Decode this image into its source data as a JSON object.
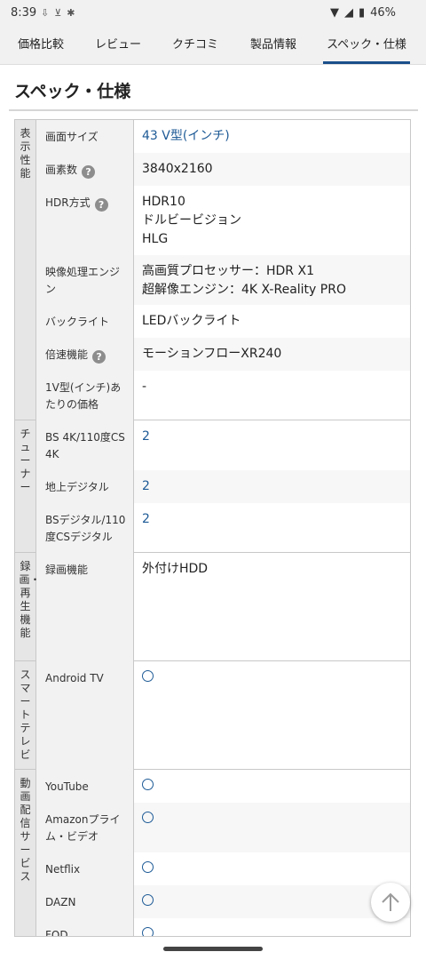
{
  "status_bar": {
    "time": "8:39",
    "battery": "46%"
  },
  "tabs": [
    "価格比較",
    "レビュー",
    "クチコミ",
    "製品情報",
    "スペック・仕様"
  ],
  "active_tab": "スペック・仕様",
  "section_title": "スペック・仕様",
  "groups": {
    "display": {
      "label": "表示性能",
      "rows": {
        "screen_size": {
          "label": "画面サイズ",
          "value": "43 V型(インチ)"
        },
        "pixels": {
          "label": "画素数",
          "value": "3840x2160"
        },
        "hdr": {
          "label": "HDR方式",
          "value": "HDR10\nドルビービジョン\nHLG"
        },
        "engine": {
          "label": "映像処理エンジン",
          "value": "高画質プロセッサー：HDR X1\n超解像エンジン：4K X-Reality PRO"
        },
        "backlight": {
          "label": "バックライト",
          "value": "LEDバックライト"
        },
        "speed": {
          "label": "倍速機能",
          "value": "モーションフローXR240"
        },
        "price_per_inch": {
          "label": "1V型(インチ)あたりの価格",
          "value": "-"
        }
      }
    },
    "tuner": {
      "label": "チューナー",
      "rows": {
        "bs4k": {
          "label": "BS 4K/110度CS 4K",
          "value": "2"
        },
        "terrestrial": {
          "label": "地上デジタル",
          "value": "2"
        },
        "bs_digital": {
          "label": "BSデジタル/110度CSデジタル",
          "value": "2"
        }
      }
    },
    "recording": {
      "label": "録画・再生機能",
      "rows": {
        "record": {
          "label": "録画機能",
          "value": "外付けHDD"
        }
      }
    },
    "smart_tv": {
      "label": "スマートテレビ",
      "rows": {
        "android_tv": {
          "label": "Android TV",
          "value": "supported"
        }
      }
    },
    "streaming": {
      "label": "動画配信サービス",
      "rows": {
        "youtube": {
          "label": "YouTube",
          "value": "supported"
        },
        "amazon": {
          "label": "Amazonプライム・ビデオ",
          "value": "supported"
        },
        "netflix": {
          "label": "Netflix",
          "value": "supported"
        },
        "dazn": {
          "label": "DAZN",
          "value": "supported"
        },
        "fod": {
          "label": "FOD",
          "value": "supported"
        }
      }
    }
  },
  "help_icon": "?",
  "colors": {
    "link": "#1d5a96",
    "tab_active_underline": "#1a4f8a",
    "label_bg": "#e6e6e6"
  }
}
